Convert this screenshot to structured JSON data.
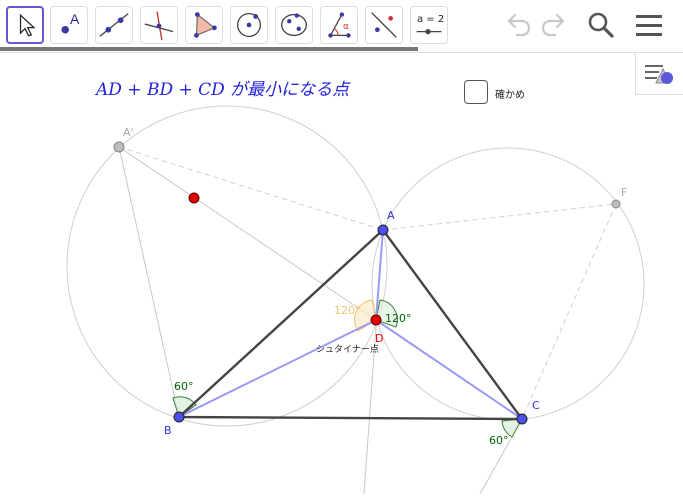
{
  "toolbar": {
    "tools": [
      {
        "name": "move-tool"
      },
      {
        "name": "point-tool",
        "label": "A"
      },
      {
        "name": "line-tool"
      },
      {
        "name": "perpendicular-line-tool"
      },
      {
        "name": "polygon-tool"
      },
      {
        "name": "circle-center-point-tool"
      },
      {
        "name": "conic-five-points-tool"
      },
      {
        "name": "angle-tool",
        "label": "α"
      },
      {
        "name": "reflect-tool"
      },
      {
        "name": "slider-tool",
        "label": "a = 2"
      }
    ],
    "right": [
      "undo-icon",
      "redo-icon",
      "search-icon",
      "menu-icon"
    ]
  },
  "canvas": {
    "formula": "AD + BD + CD が最小になる点",
    "checkbox_label": "確かめ",
    "points": {
      "A_prime": "A'",
      "F": "F",
      "A": "A",
      "B": "B",
      "C": "C",
      "D": "D"
    },
    "angles": {
      "angle_120_orange": "120°",
      "angle_120_green": "120°",
      "angle_60_B": "60°",
      "angle_60_C": "60°"
    },
    "steiner_label": "シュタイナー点"
  },
  "colors": {
    "point_blue": "#4d4df0",
    "point_red": "#e00000",
    "point_gray": "#aaaaaa",
    "steiner_lines": "#9a9af5",
    "triangle_edges": "#444444",
    "angle_green": "#006400",
    "angle_orange": "#f5c06a",
    "label_blue": "#3333dd",
    "formula_blue": "#2222dd"
  }
}
